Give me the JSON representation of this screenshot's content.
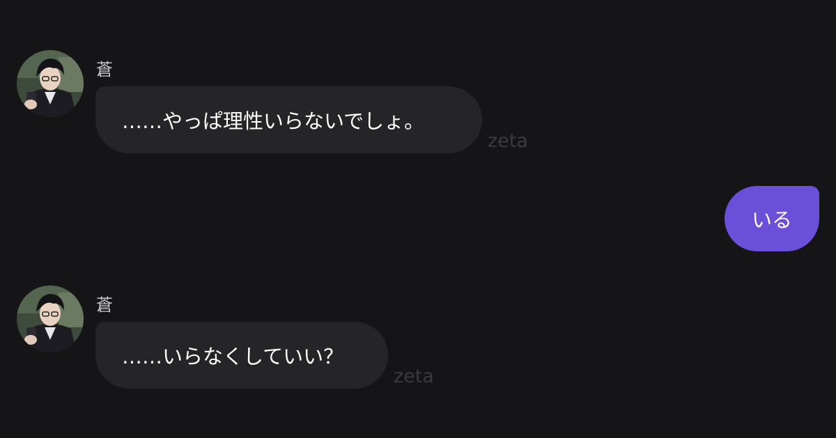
{
  "messages": [
    {
      "role": "assistant",
      "sender": "蒼",
      "text": "……やっぱ理性いらないでしょ。",
      "watermark": "zeta"
    },
    {
      "role": "user",
      "text": "いる"
    },
    {
      "role": "assistant",
      "sender": "蒼",
      "text": "……いらなくしていい？",
      "watermark": "zeta"
    }
  ],
  "colors": {
    "background": "#151417",
    "incoming_bubble": "#252528",
    "outgoing_bubble": "#6a4fd8",
    "sender_text": "#c9c9cc",
    "watermark": "#3b3a3f"
  }
}
